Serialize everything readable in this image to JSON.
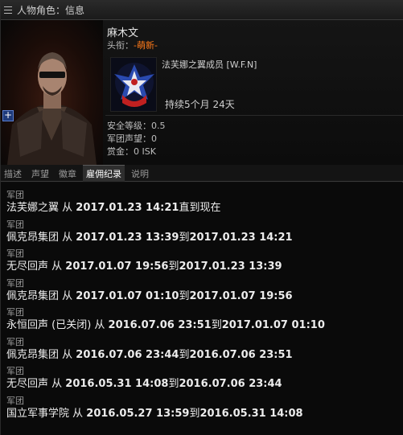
{
  "window": {
    "title": "人物角色：信息"
  },
  "character": {
    "name": "麻木文",
    "title_label": "头衔：",
    "title_value": "-萌新-"
  },
  "corporation": {
    "name": "法芙娜之翼成员 [W.F.N]",
    "duration": "持续5个月 24天"
  },
  "stats": {
    "security": "安全等级：0.5",
    "military_standing": "军团声望：0",
    "bounty": "赏金：0 ISK"
  },
  "tabs": [
    {
      "label": "描述",
      "active": false
    },
    {
      "label": "声望",
      "active": false
    },
    {
      "label": "徽章",
      "active": false
    },
    {
      "label": "雇佣纪录",
      "active": true
    },
    {
      "label": "说明",
      "active": false
    }
  ],
  "history": [
    {
      "label": "军团",
      "corp": "法芙娜之翼",
      "from": " 从 ",
      "start": "2017.01.23 14:21",
      "to": "直到现在",
      "end": ""
    },
    {
      "label": "军团",
      "corp": "佩克昂集团",
      "from": " 从 ",
      "start": "2017.01.23 13:39",
      "to": "到",
      "end": "2017.01.23 14:21"
    },
    {
      "label": "军团",
      "corp": "无尽回声",
      "from": " 从 ",
      "start": "2017.01.07 19:56",
      "to": "到",
      "end": "2017.01.23 13:39"
    },
    {
      "label": "军团",
      "corp": "佩克昂集团",
      "from": " 从 ",
      "start": "2017.01.07 01:10",
      "to": "到",
      "end": "2017.01.07 19:56"
    },
    {
      "label": "军团",
      "corp": " 永恒回声 (已关闭)",
      "from": " 从 ",
      "start": "2016.07.06 23:51",
      "to": "到",
      "end": "2017.01.07 01:10"
    },
    {
      "label": "军团",
      "corp": "佩克昂集团",
      "from": " 从 ",
      "start": "2016.07.06 23:44",
      "to": "到",
      "end": "2016.07.06 23:51"
    },
    {
      "label": "军团",
      "corp": "无尽回声",
      "from": " 从 ",
      "start": "2016.05.31 14:08",
      "to": "到",
      "end": "2016.07.06 23:44"
    },
    {
      "label": "军团",
      "corp": "国立军事学院",
      "from": " 从 ",
      "start": "2016.05.27 13:59",
      "to": "到",
      "end": "2016.05.31 14:08"
    }
  ],
  "icons": {
    "menu": "menu-icon",
    "portrait_add": "plus-icon",
    "corp_logo": "eagle-emblem-icon"
  },
  "colors": {
    "title_value": "#ff7a1a",
    "active_tab": "#2e2e2e",
    "background": "#0a0a0a"
  }
}
